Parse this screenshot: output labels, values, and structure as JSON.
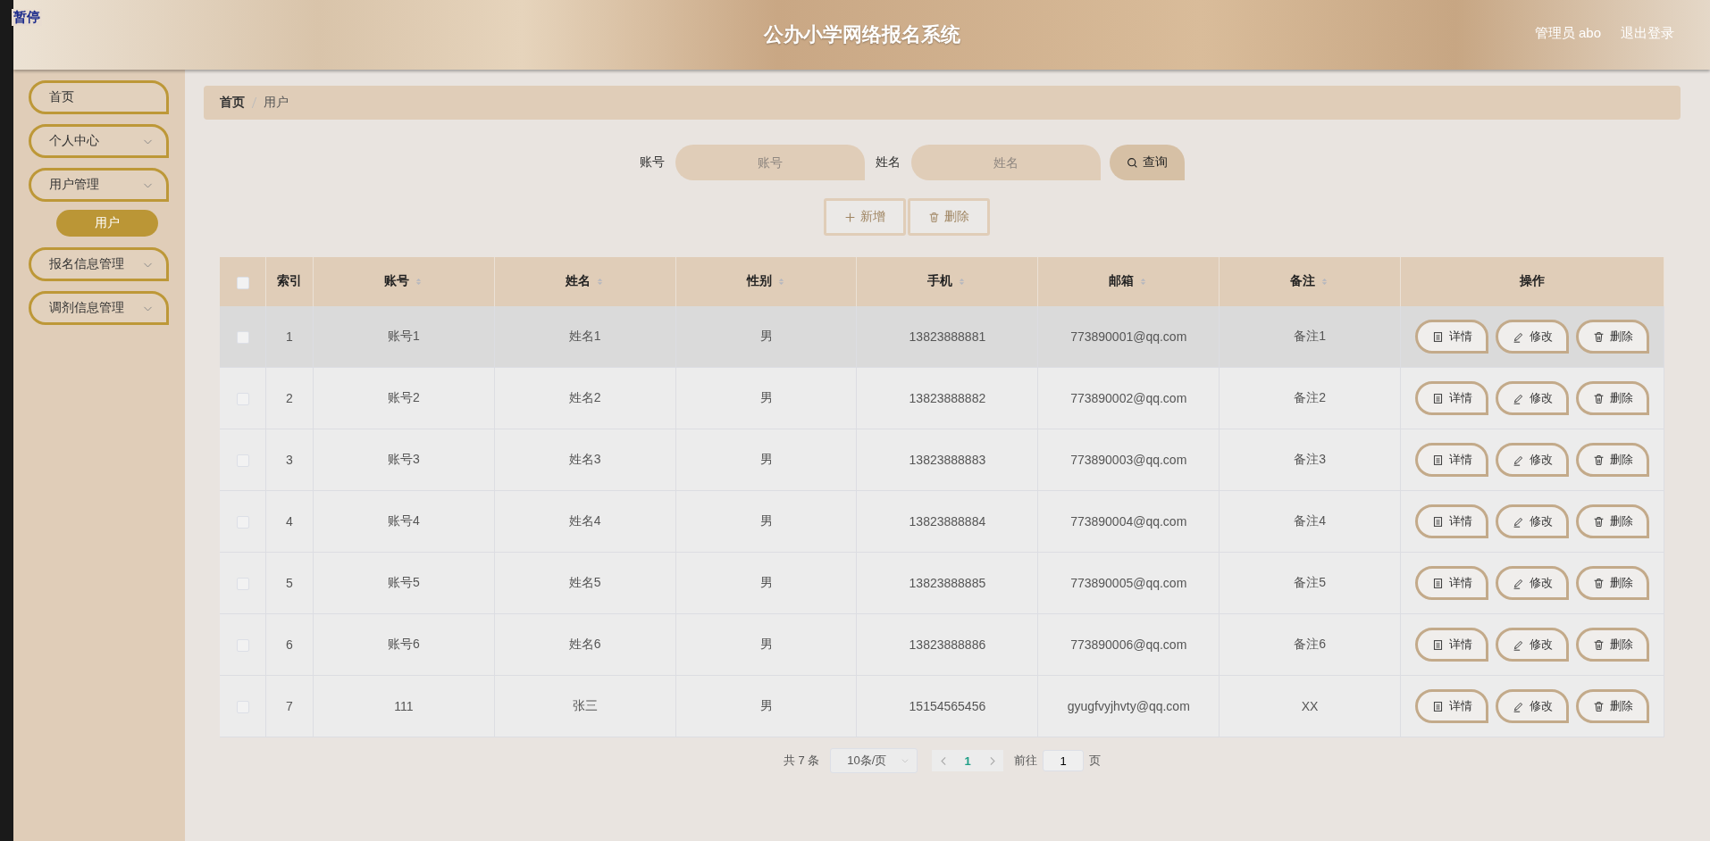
{
  "overlay_label": "暂停",
  "header": {
    "title": "公办小学网络报名系统",
    "user": "管理员 abo",
    "logout": "退出登录"
  },
  "sidebar": {
    "items": [
      {
        "label": "首页",
        "expandable": false
      },
      {
        "label": "个人中心",
        "expandable": true
      },
      {
        "label": "用户管理",
        "expandable": true,
        "children": [
          {
            "label": "用户",
            "selected": true
          }
        ]
      },
      {
        "label": "报名信息管理",
        "expandable": true
      },
      {
        "label": "调剂信息管理",
        "expandable": true
      }
    ]
  },
  "breadcrumb": [
    {
      "label": "首页",
      "current": false
    },
    {
      "label": "用户",
      "current": true
    }
  ],
  "search": {
    "fields": [
      {
        "label": "账号",
        "placeholder": "账号"
      },
      {
        "label": "姓名",
        "placeholder": "姓名"
      }
    ],
    "button": "查询"
  },
  "actions": [
    {
      "kind": "add",
      "label": "新增",
      "disabled": true
    },
    {
      "kind": "delete",
      "label": "删除",
      "disabled": true
    }
  ],
  "table": {
    "select_all_checked": false,
    "columns": [
      {
        "label": "索引",
        "sortable": false
      },
      {
        "label": "账号",
        "sortable": true
      },
      {
        "label": "姓名",
        "sortable": true
      },
      {
        "label": "性别",
        "sortable": true
      },
      {
        "label": "手机",
        "sortable": true
      },
      {
        "label": "邮箱",
        "sortable": true
      },
      {
        "label": "备注",
        "sortable": true
      },
      {
        "label": "操作",
        "sortable": false
      }
    ],
    "rows": [
      {
        "checked": false,
        "highlighted": true,
        "cells": [
          "1",
          "账号1",
          "姓名1",
          "男",
          "13823888881",
          "773890001@qq.com",
          "备注1"
        ],
        "buttons": [
          {
            "kind": "detail",
            "label": "详情"
          },
          {
            "kind": "edit",
            "label": "修改"
          },
          {
            "kind": "delete",
            "label": "删除"
          }
        ]
      },
      {
        "checked": false,
        "highlighted": false,
        "cells": [
          "2",
          "账号2",
          "姓名2",
          "男",
          "13823888882",
          "773890002@qq.com",
          "备注2"
        ],
        "buttons": [
          {
            "kind": "detail",
            "label": "详情"
          },
          {
            "kind": "edit",
            "label": "修改"
          },
          {
            "kind": "delete",
            "label": "删除"
          }
        ]
      },
      {
        "checked": false,
        "highlighted": false,
        "cells": [
          "3",
          "账号3",
          "姓名3",
          "男",
          "13823888883",
          "773890003@qq.com",
          "备注3"
        ],
        "buttons": [
          {
            "kind": "detail",
            "label": "详情"
          },
          {
            "kind": "edit",
            "label": "修改"
          },
          {
            "kind": "delete",
            "label": "删除"
          }
        ]
      },
      {
        "checked": false,
        "highlighted": false,
        "cells": [
          "4",
          "账号4",
          "姓名4",
          "男",
          "13823888884",
          "773890004@qq.com",
          "备注4"
        ],
        "buttons": [
          {
            "kind": "detail",
            "label": "详情"
          },
          {
            "kind": "edit",
            "label": "修改"
          },
          {
            "kind": "delete",
            "label": "删除"
          }
        ]
      },
      {
        "checked": false,
        "highlighted": false,
        "cells": [
          "5",
          "账号5",
          "姓名5",
          "男",
          "13823888885",
          "773890005@qq.com",
          "备注5"
        ],
        "buttons": [
          {
            "kind": "detail",
            "label": "详情"
          },
          {
            "kind": "edit",
            "label": "修改"
          },
          {
            "kind": "delete",
            "label": "删除"
          }
        ]
      },
      {
        "checked": false,
        "highlighted": false,
        "cells": [
          "6",
          "账号6",
          "姓名6",
          "男",
          "13823888886",
          "773890006@qq.com",
          "备注6"
        ],
        "buttons": [
          {
            "kind": "detail",
            "label": "详情"
          },
          {
            "kind": "edit",
            "label": "修改"
          },
          {
            "kind": "delete",
            "label": "删除"
          }
        ]
      },
      {
        "checked": false,
        "highlighted": false,
        "cells": [
          "7",
          "111",
          "张三",
          "男",
          "15154565456",
          "gyugfvyjhvty@qq.com",
          "XX"
        ],
        "buttons": [
          {
            "kind": "detail",
            "label": "详情"
          },
          {
            "kind": "edit",
            "label": "修改"
          },
          {
            "kind": "delete",
            "label": "删除"
          }
        ]
      }
    ]
  },
  "pagination": {
    "total": "共 7 条",
    "page_size": "10条/页",
    "pages": [
      {
        "label": "1",
        "selected": true
      }
    ],
    "goto_label": "前往",
    "goto_value": "1",
    "page_suffix": "页"
  }
}
